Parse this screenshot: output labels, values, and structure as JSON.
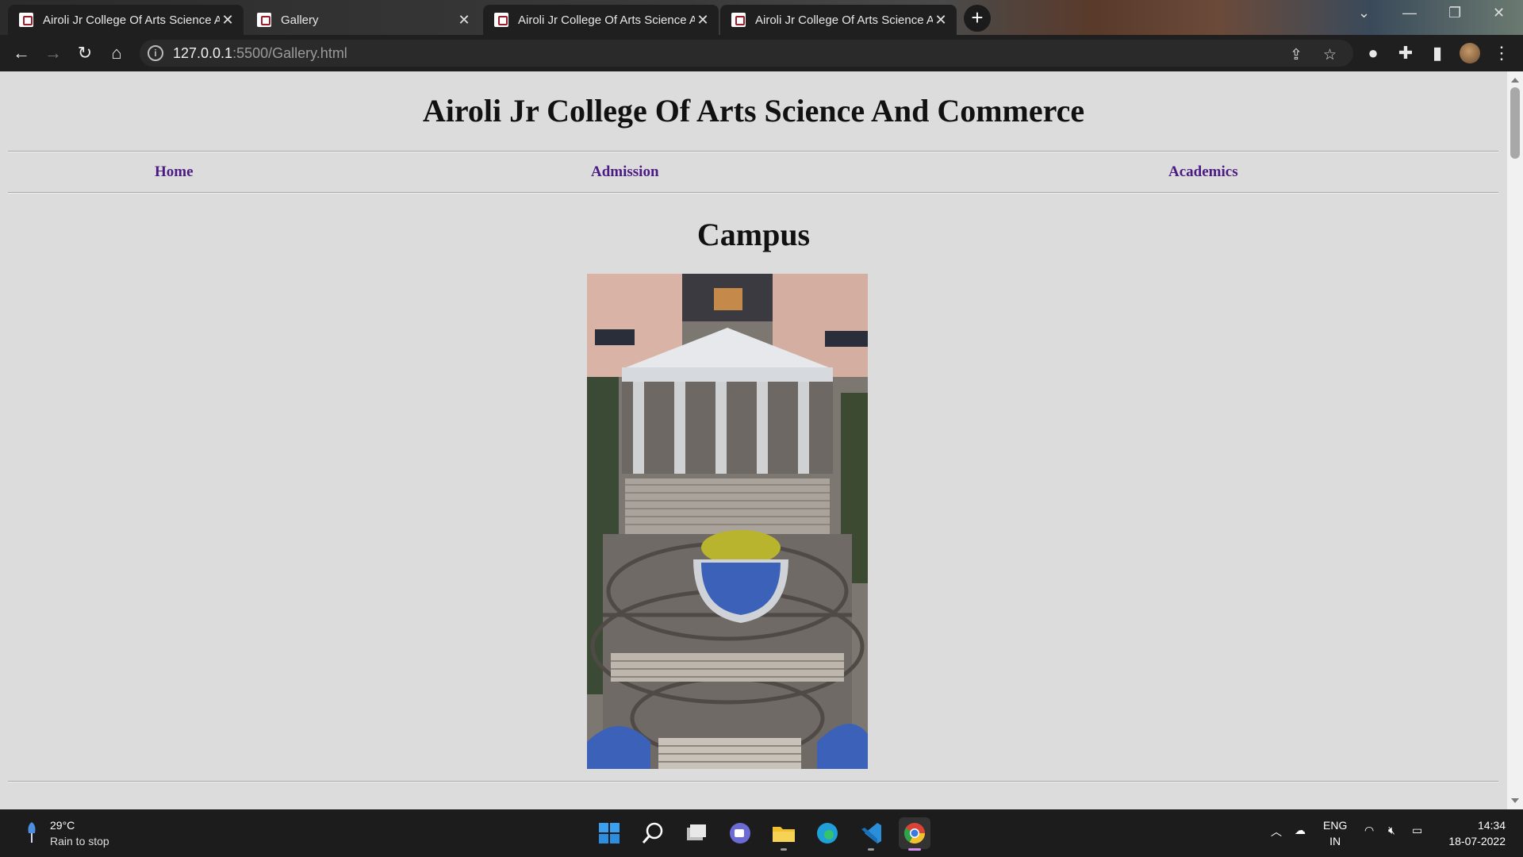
{
  "browser": {
    "tabs": [
      {
        "title": "Airoli Jr College Of Arts Science And Commerce",
        "active": false
      },
      {
        "title": "Gallery",
        "active": false
      },
      {
        "title": "Airoli Jr College Of Arts Science And Commerce",
        "active": false
      },
      {
        "title": "Airoli Jr College Of Arts Science And Commerce",
        "active": true
      }
    ],
    "new_tab_label": "+",
    "url_host": "127.0.0.1",
    "url_rest": ":5500/Gallery.html"
  },
  "page": {
    "site_title": "Airoli Jr College Of Arts Science And Commerce",
    "nav": [
      {
        "label": "Home"
      },
      {
        "label": "Admission"
      },
      {
        "label": "Academics"
      }
    ],
    "section_title": "Campus",
    "campus_image_alt": "Campus"
  },
  "taskbar": {
    "weather_temp": "29°C",
    "weather_desc": "Rain to stop",
    "lang_line1": "ENG",
    "lang_line2": "IN",
    "time": "14:34",
    "date": "18-07-2022"
  },
  "colors": {
    "nav_link": "#4b1a82",
    "page_bg": "#dcdcdc",
    "chrome_dark": "#1f1f1f"
  }
}
